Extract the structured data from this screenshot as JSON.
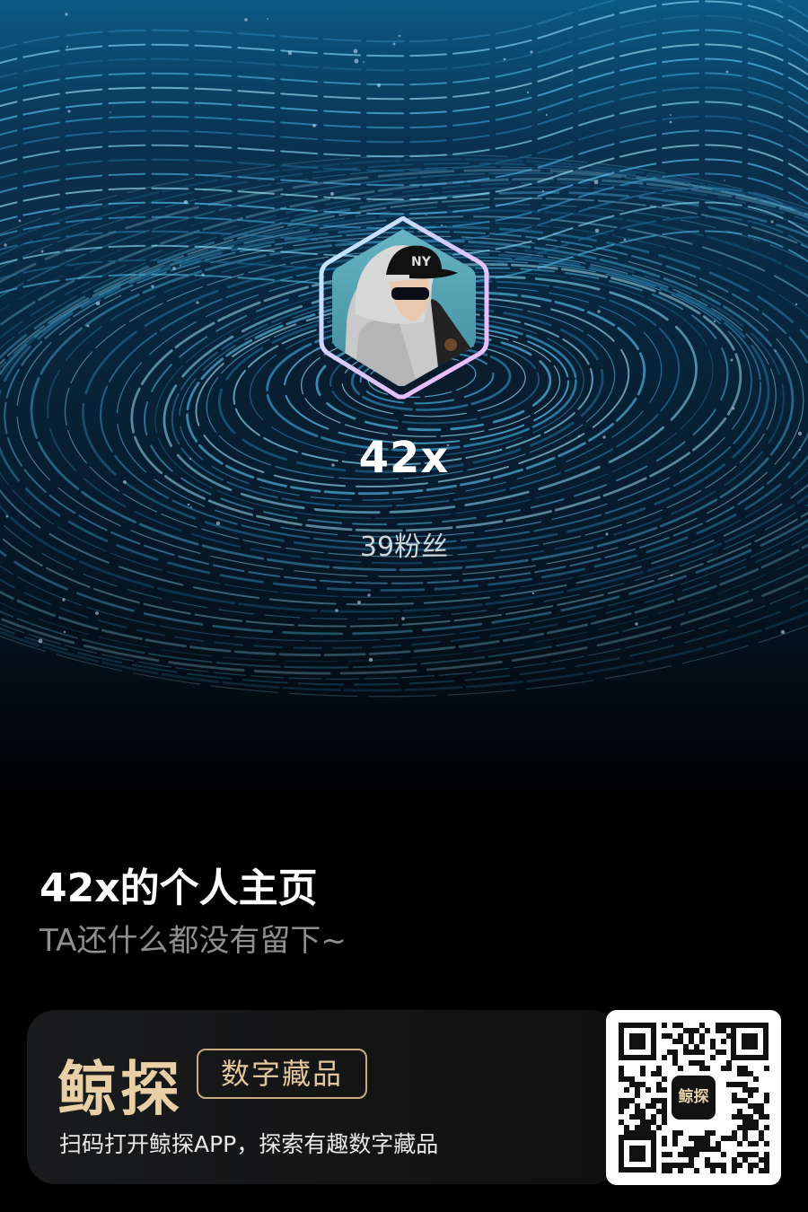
{
  "profile": {
    "username": "42x",
    "fans": "39粉丝"
  },
  "page": {
    "title": "42x的个人主页",
    "subtitle": "TA还什么都没有留下~"
  },
  "banner": {
    "brand": "鲸探",
    "badge": "数字藏品",
    "tagline": "扫码打开鲸探APP，探索有趣数字藏品",
    "qr_logo": "鲸探"
  },
  "colors": {
    "accent_gold": "#e8cfa6",
    "avatar_border_start": "#b8f0ff",
    "avatar_border_end": "#f5b6ff"
  },
  "icons": {
    "qr": "qr-code-icon",
    "avatar": "avatar-image"
  }
}
